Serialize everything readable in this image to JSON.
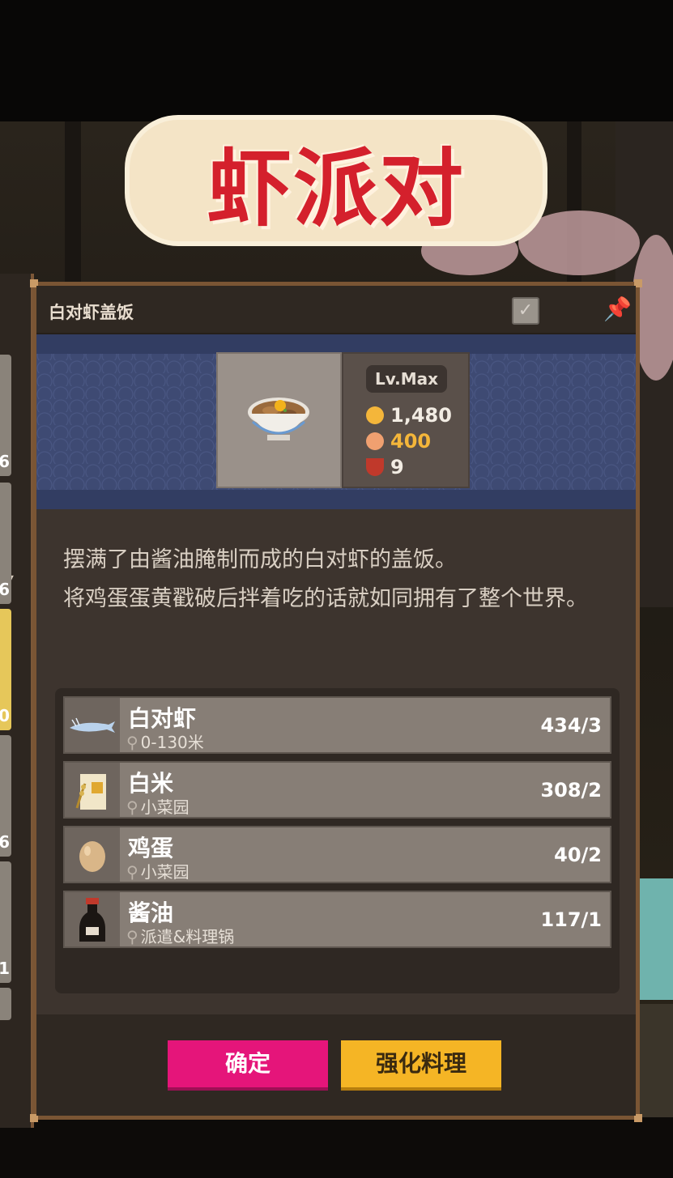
{
  "title_banner": "虾派对",
  "left_list": {
    "numbers": [
      "6",
      "6",
      "0",
      "6",
      "1"
    ]
  },
  "recipe": {
    "name": "白对虾盖饭",
    "level": "Lv.Max",
    "price": "1,480",
    "taste": "400",
    "servings": "9",
    "description": [
      "摆满了由酱油腌制而成的白对虾的盖饭。",
      "将鸡蛋蛋黄戳破后拌着吃的话就如同拥有了整个世界。"
    ]
  },
  "ingredients": [
    {
      "name": "白对虾",
      "location": "0-130米",
      "qty": "434/3",
      "icon": "shrimp-icon"
    },
    {
      "name": "白米",
      "location": "小菜园",
      "qty": "308/2",
      "icon": "rice-bag-icon"
    },
    {
      "name": "鸡蛋",
      "location": "小菜园",
      "qty": "40/2",
      "icon": "egg-icon"
    },
    {
      "name": "酱油",
      "location": "派遣&料理锅",
      "qty": "117/1",
      "icon": "soy-sauce-icon"
    }
  ],
  "buttons": {
    "confirm": "确定",
    "enhance": "强化料理"
  },
  "colors": {
    "confirm": "#e5157a",
    "enhance": "#f5b525",
    "panel_border": "#7a5534",
    "banner_bg": "#3e4a73",
    "title_text": "#d4202c"
  }
}
